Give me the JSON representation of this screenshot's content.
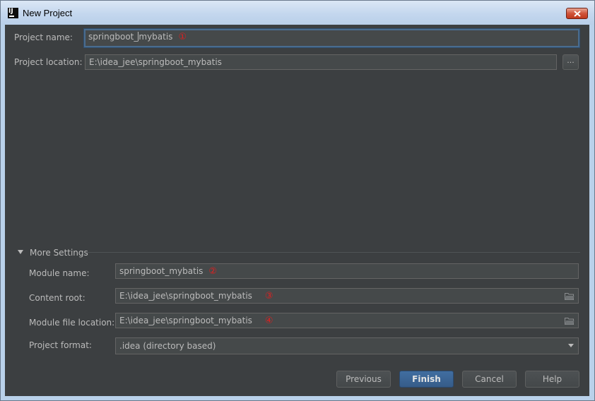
{
  "window": {
    "title": "New Project"
  },
  "icons": {
    "app": "intellij-idea-icon",
    "close": "close-icon"
  },
  "colors": {
    "background": "#3c3f41",
    "field": "#45494a",
    "text": "#bbbbbb",
    "marker": "#e02020",
    "primary": "#365c89"
  },
  "project": {
    "name_label": "Project name:",
    "name_value_before_caret": "springboot_",
    "name_value_after_caret": "mybatis",
    "name_marker": "①",
    "location_label": "Project location:",
    "location_value": "E:\\idea_jee\\springboot_mybatis",
    "browse_label": "..."
  },
  "more_settings": {
    "title": "More Settings",
    "module_name_label": "Module name:",
    "module_name_value": "springboot_mybatis",
    "module_name_marker": "②",
    "content_root_label": "Content root:",
    "content_root_value": "E:\\idea_jee\\springboot_mybatis",
    "content_root_marker": "③",
    "module_file_label": "Module file location:",
    "module_file_value": "E:\\idea_jee\\springboot_mybatis",
    "module_file_marker": "④",
    "format_label": "Project format:",
    "format_value": ".idea (directory based)"
  },
  "buttons": {
    "previous": "Previous",
    "finish": "Finish",
    "cancel": "Cancel",
    "help": "Help"
  }
}
